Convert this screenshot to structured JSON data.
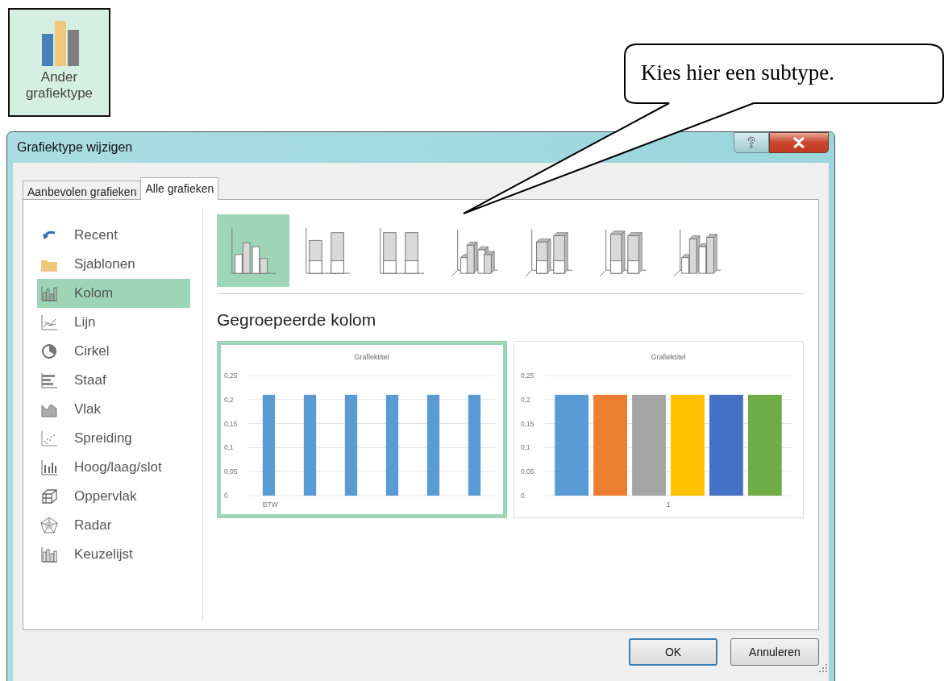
{
  "ribbon_button": {
    "label": "Ander grafiektype"
  },
  "callout": {
    "text": "Kies hier een subtype."
  },
  "window": {
    "title": "Grafiektype wijzigen"
  },
  "tabs": [
    {
      "label": "Aanbevolen grafieken",
      "selected": false
    },
    {
      "label": "Alle grafieken",
      "selected": true
    }
  ],
  "sidebar": {
    "items": [
      {
        "label": "Recent",
        "selected": false
      },
      {
        "label": "Sjablonen",
        "selected": false
      },
      {
        "label": "Kolom",
        "selected": true
      },
      {
        "label": "Lijn",
        "selected": false
      },
      {
        "label": "Cirkel",
        "selected": false
      },
      {
        "label": "Staaf",
        "selected": false
      },
      {
        "label": "Vlak",
        "selected": false
      },
      {
        "label": "Spreiding",
        "selected": false
      },
      {
        "label": "Hoog/laag/slot",
        "selected": false
      },
      {
        "label": "Oppervlak",
        "selected": false
      },
      {
        "label": "Radar",
        "selected": false
      },
      {
        "label": "Keuzelijst",
        "selected": false
      }
    ]
  },
  "subtypes": [
    {
      "selected": true
    },
    {
      "selected": false
    },
    {
      "selected": false
    },
    {
      "selected": false
    },
    {
      "selected": false
    },
    {
      "selected": false
    },
    {
      "selected": false
    }
  ],
  "subtype_title": "Gegroepeerde kolom",
  "previews": [
    {
      "selected": true,
      "chart_data": {
        "type": "bar",
        "grid": true,
        "title": "Grafiektitel",
        "categories": [
          "BTW",
          null,
          null,
          null,
          null,
          null
        ],
        "series": [
          {
            "color": "#5b9bd5",
            "values": [
              0.21,
              0.21,
              0.21,
              0.21,
              0.21,
              0.21
            ]
          }
        ],
        "ylim": [
          0,
          0.25
        ],
        "yticks": [
          {
            "value": 0,
            "label": "0"
          },
          {
            "value": 0.05,
            "label": "0,05"
          },
          {
            "value": 0.1,
            "label": "0,1"
          },
          {
            "value": 0.15,
            "label": "0,15"
          },
          {
            "value": 0.2,
            "label": "0,2"
          },
          {
            "value": 0.25,
            "label": "0,25"
          }
        ]
      }
    },
    {
      "selected": false,
      "chart_data": {
        "type": "bar",
        "grid": true,
        "title": "Grafiektitel",
        "categories": [
          "1"
        ],
        "series": [
          {
            "color": "#5b9bd5",
            "values": [
              0.21
            ]
          },
          {
            "color": "#ed7d31",
            "values": [
              0.21
            ]
          },
          {
            "color": "#a5a5a5",
            "values": [
              0.21
            ]
          },
          {
            "color": "#ffc000",
            "values": [
              0.21
            ]
          },
          {
            "color": "#4472c4",
            "values": [
              0.21
            ]
          },
          {
            "color": "#70ad47",
            "values": [
              0.21
            ]
          }
        ],
        "ylim": [
          0,
          0.25
        ],
        "yticks": [
          {
            "value": 0,
            "label": "0"
          },
          {
            "value": 0.05,
            "label": "0,05"
          },
          {
            "value": 0.1,
            "label": "0,1"
          },
          {
            "value": 0.15,
            "label": "0,15"
          },
          {
            "value": 0.2,
            "label": "0,2"
          },
          {
            "value": 0.25,
            "label": "0,25"
          }
        ]
      }
    }
  ],
  "buttons": [
    {
      "label": "OK",
      "kind": "default"
    },
    {
      "label": "Annuleren",
      "kind": "normal"
    }
  ]
}
